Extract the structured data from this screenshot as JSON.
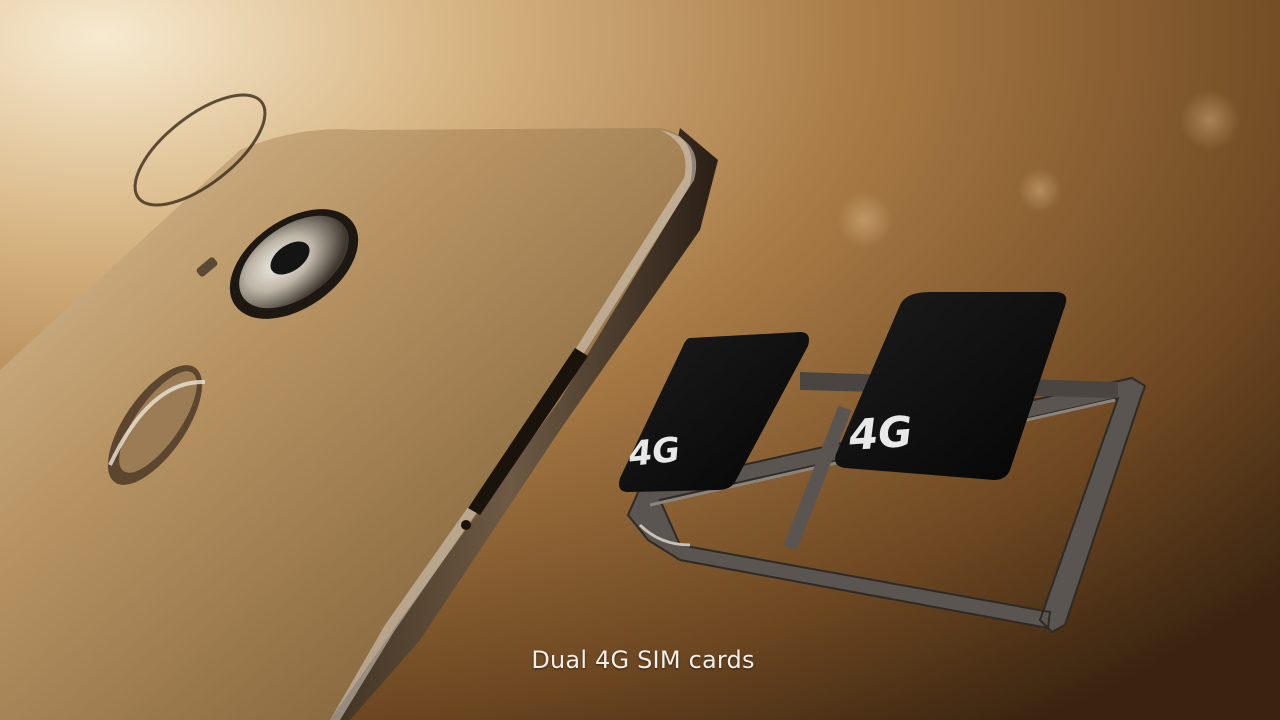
{
  "caption": {
    "text": "Dual 4G SIM cards"
  },
  "sim_cards": [
    {
      "label": "4G"
    },
    {
      "label": "4G"
    }
  ],
  "colors": {
    "background_highlight": "#f3dfb8",
    "background_shadow": "#3a2410",
    "phone_body": "#b89464",
    "sim_card": "#101010",
    "sim_tray": "#5a5550",
    "caption_text": "#f4efe8"
  }
}
